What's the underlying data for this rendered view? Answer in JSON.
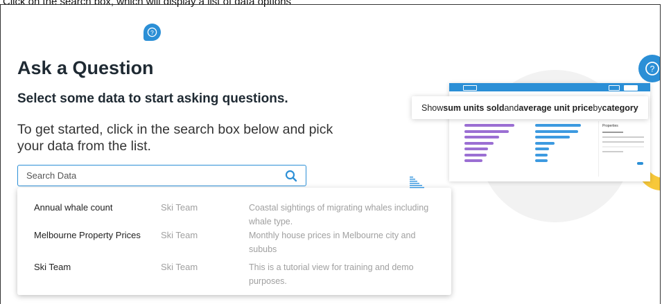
{
  "caption": "Click on the search box, which will display a list of data options",
  "page": {
    "title": "Ask a Question",
    "subtitle": "Select some data to start asking questions.",
    "intro": "To get started, click in the search box below and pick your data from the list."
  },
  "search": {
    "placeholder": "Search Data",
    "icon": "search-icon"
  },
  "results": [
    {
      "name": "Annual whale count",
      "source": "Ski Team",
      "description": "Coastal sightings of migrating whales including whale type."
    },
    {
      "name": "Melbourne Property Prices",
      "source": "Ski Team",
      "description": "Monthly house prices in Melbourne city and sububs"
    },
    {
      "name": "Ski Team",
      "source": "Ski Team",
      "description": "This is a tutorial view for training and demo purposes."
    }
  ],
  "illustration": {
    "callout_parts": [
      "Show ",
      "sum units sold",
      " and ",
      "average unit price",
      " by ",
      "category"
    ],
    "panel_title": "Properties"
  },
  "colors": {
    "accent": "#2b8fd6",
    "purple": "#9b6fd3",
    "blue": "#3d9ae0",
    "yellow": "#f7c83a"
  }
}
